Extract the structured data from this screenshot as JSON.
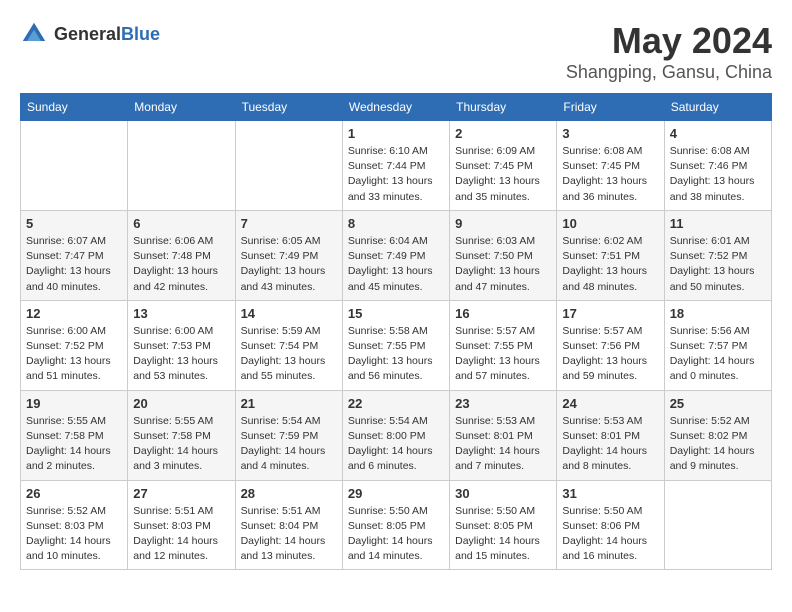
{
  "header": {
    "logo_general": "General",
    "logo_blue": "Blue",
    "month_title": "May 2024",
    "location": "Shangping, Gansu, China"
  },
  "weekdays": [
    "Sunday",
    "Monday",
    "Tuesday",
    "Wednesday",
    "Thursday",
    "Friday",
    "Saturday"
  ],
  "weeks": [
    [
      {
        "day": null,
        "info": null
      },
      {
        "day": null,
        "info": null
      },
      {
        "day": null,
        "info": null
      },
      {
        "day": "1",
        "info": "Sunrise: 6:10 AM\nSunset: 7:44 PM\nDaylight: 13 hours\nand 33 minutes."
      },
      {
        "day": "2",
        "info": "Sunrise: 6:09 AM\nSunset: 7:45 PM\nDaylight: 13 hours\nand 35 minutes."
      },
      {
        "day": "3",
        "info": "Sunrise: 6:08 AM\nSunset: 7:45 PM\nDaylight: 13 hours\nand 36 minutes."
      },
      {
        "day": "4",
        "info": "Sunrise: 6:08 AM\nSunset: 7:46 PM\nDaylight: 13 hours\nand 38 minutes."
      }
    ],
    [
      {
        "day": "5",
        "info": "Sunrise: 6:07 AM\nSunset: 7:47 PM\nDaylight: 13 hours\nand 40 minutes."
      },
      {
        "day": "6",
        "info": "Sunrise: 6:06 AM\nSunset: 7:48 PM\nDaylight: 13 hours\nand 42 minutes."
      },
      {
        "day": "7",
        "info": "Sunrise: 6:05 AM\nSunset: 7:49 PM\nDaylight: 13 hours\nand 43 minutes."
      },
      {
        "day": "8",
        "info": "Sunrise: 6:04 AM\nSunset: 7:49 PM\nDaylight: 13 hours\nand 45 minutes."
      },
      {
        "day": "9",
        "info": "Sunrise: 6:03 AM\nSunset: 7:50 PM\nDaylight: 13 hours\nand 47 minutes."
      },
      {
        "day": "10",
        "info": "Sunrise: 6:02 AM\nSunset: 7:51 PM\nDaylight: 13 hours\nand 48 minutes."
      },
      {
        "day": "11",
        "info": "Sunrise: 6:01 AM\nSunset: 7:52 PM\nDaylight: 13 hours\nand 50 minutes."
      }
    ],
    [
      {
        "day": "12",
        "info": "Sunrise: 6:00 AM\nSunset: 7:52 PM\nDaylight: 13 hours\nand 51 minutes."
      },
      {
        "day": "13",
        "info": "Sunrise: 6:00 AM\nSunset: 7:53 PM\nDaylight: 13 hours\nand 53 minutes."
      },
      {
        "day": "14",
        "info": "Sunrise: 5:59 AM\nSunset: 7:54 PM\nDaylight: 13 hours\nand 55 minutes."
      },
      {
        "day": "15",
        "info": "Sunrise: 5:58 AM\nSunset: 7:55 PM\nDaylight: 13 hours\nand 56 minutes."
      },
      {
        "day": "16",
        "info": "Sunrise: 5:57 AM\nSunset: 7:55 PM\nDaylight: 13 hours\nand 57 minutes."
      },
      {
        "day": "17",
        "info": "Sunrise: 5:57 AM\nSunset: 7:56 PM\nDaylight: 13 hours\nand 59 minutes."
      },
      {
        "day": "18",
        "info": "Sunrise: 5:56 AM\nSunset: 7:57 PM\nDaylight: 14 hours\nand 0 minutes."
      }
    ],
    [
      {
        "day": "19",
        "info": "Sunrise: 5:55 AM\nSunset: 7:58 PM\nDaylight: 14 hours\nand 2 minutes."
      },
      {
        "day": "20",
        "info": "Sunrise: 5:55 AM\nSunset: 7:58 PM\nDaylight: 14 hours\nand 3 minutes."
      },
      {
        "day": "21",
        "info": "Sunrise: 5:54 AM\nSunset: 7:59 PM\nDaylight: 14 hours\nand 4 minutes."
      },
      {
        "day": "22",
        "info": "Sunrise: 5:54 AM\nSunset: 8:00 PM\nDaylight: 14 hours\nand 6 minutes."
      },
      {
        "day": "23",
        "info": "Sunrise: 5:53 AM\nSunset: 8:01 PM\nDaylight: 14 hours\nand 7 minutes."
      },
      {
        "day": "24",
        "info": "Sunrise: 5:53 AM\nSunset: 8:01 PM\nDaylight: 14 hours\nand 8 minutes."
      },
      {
        "day": "25",
        "info": "Sunrise: 5:52 AM\nSunset: 8:02 PM\nDaylight: 14 hours\nand 9 minutes."
      }
    ],
    [
      {
        "day": "26",
        "info": "Sunrise: 5:52 AM\nSunset: 8:03 PM\nDaylight: 14 hours\nand 10 minutes."
      },
      {
        "day": "27",
        "info": "Sunrise: 5:51 AM\nSunset: 8:03 PM\nDaylight: 14 hours\nand 12 minutes."
      },
      {
        "day": "28",
        "info": "Sunrise: 5:51 AM\nSunset: 8:04 PM\nDaylight: 14 hours\nand 13 minutes."
      },
      {
        "day": "29",
        "info": "Sunrise: 5:50 AM\nSunset: 8:05 PM\nDaylight: 14 hours\nand 14 minutes."
      },
      {
        "day": "30",
        "info": "Sunrise: 5:50 AM\nSunset: 8:05 PM\nDaylight: 14 hours\nand 15 minutes."
      },
      {
        "day": "31",
        "info": "Sunrise: 5:50 AM\nSunset: 8:06 PM\nDaylight: 14 hours\nand 16 minutes."
      },
      {
        "day": null,
        "info": null
      }
    ]
  ]
}
